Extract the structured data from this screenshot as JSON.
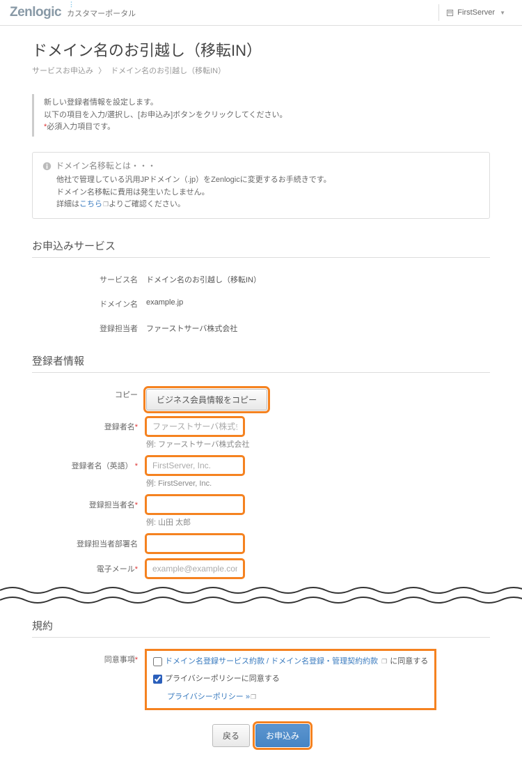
{
  "header": {
    "logo": "Zenlogic",
    "portal_name": "カスタマーポータル",
    "user_label": "FirstServer"
  },
  "page": {
    "title": "ドメイン名のお引越し（移転IN）",
    "breadcrumb": {
      "item1": "サービスお申込み",
      "item2": "ドメイン名のお引越し（移転IN）"
    }
  },
  "instructions": {
    "line1": "新しい登録者情報を設定します。",
    "line2": "以下の項目を入力/選択し、[お申込み]ボタンをクリックしてください。",
    "req": "*",
    "req_text": "必須入力項目です。"
  },
  "info": {
    "heading": "ドメイン名移転とは・・・",
    "body1": "他社で管理している汎用JPドメイン（.jp）をZenlogicに変更するお手続きです。",
    "body2": "ドメイン名移転に費用は発生いたしません。",
    "body3_pre": "詳細は",
    "body3_link": "こちら",
    "body3_post": "よりご確認ください。"
  },
  "service": {
    "section_title": "お申込みサービス",
    "rows": {
      "service_name": {
        "label": "サービス名",
        "value": "ドメイン名のお引越し（移転IN）"
      },
      "domain_name": {
        "label": "ドメイン名",
        "value": "example.jp"
      },
      "reg_agent": {
        "label": "登録担当者",
        "value": "ファーストサーバ株式会社"
      }
    }
  },
  "registrant": {
    "section_title": "登録者情報",
    "copy_label": "コピー",
    "copy_button": "ビジネス会員情報をコピー",
    "fields": {
      "name": {
        "label": "登録者名",
        "placeholder": "ファーストサーバ株式会社",
        "example": "例: ファーストサーバ株式会社"
      },
      "name_en": {
        "label": "登録者名（英語）",
        "placeholder": "FirstServer, Inc.",
        "example": "例: FirstServer, Inc."
      },
      "contact": {
        "label": "登録担当者名",
        "placeholder": "",
        "example": "例: 山田 太郎"
      },
      "dept": {
        "label": "登録担当者部署名",
        "placeholder": "",
        "example": ""
      },
      "email": {
        "label": "電子メール",
        "placeholder": "example@example.com",
        "example": ""
      }
    }
  },
  "terms": {
    "section_title": "規約",
    "consent_label": "同意事項",
    "link1": "ドメイン名登録サービス約款 / ドメイン名登録・管理契約約款",
    "link1_suffix": " に同意する",
    "line2": "プライバシーポリシーに同意する",
    "pp_link": "プライバシーポリシー »"
  },
  "actions": {
    "back": "戻る",
    "submit": "お申込み"
  }
}
